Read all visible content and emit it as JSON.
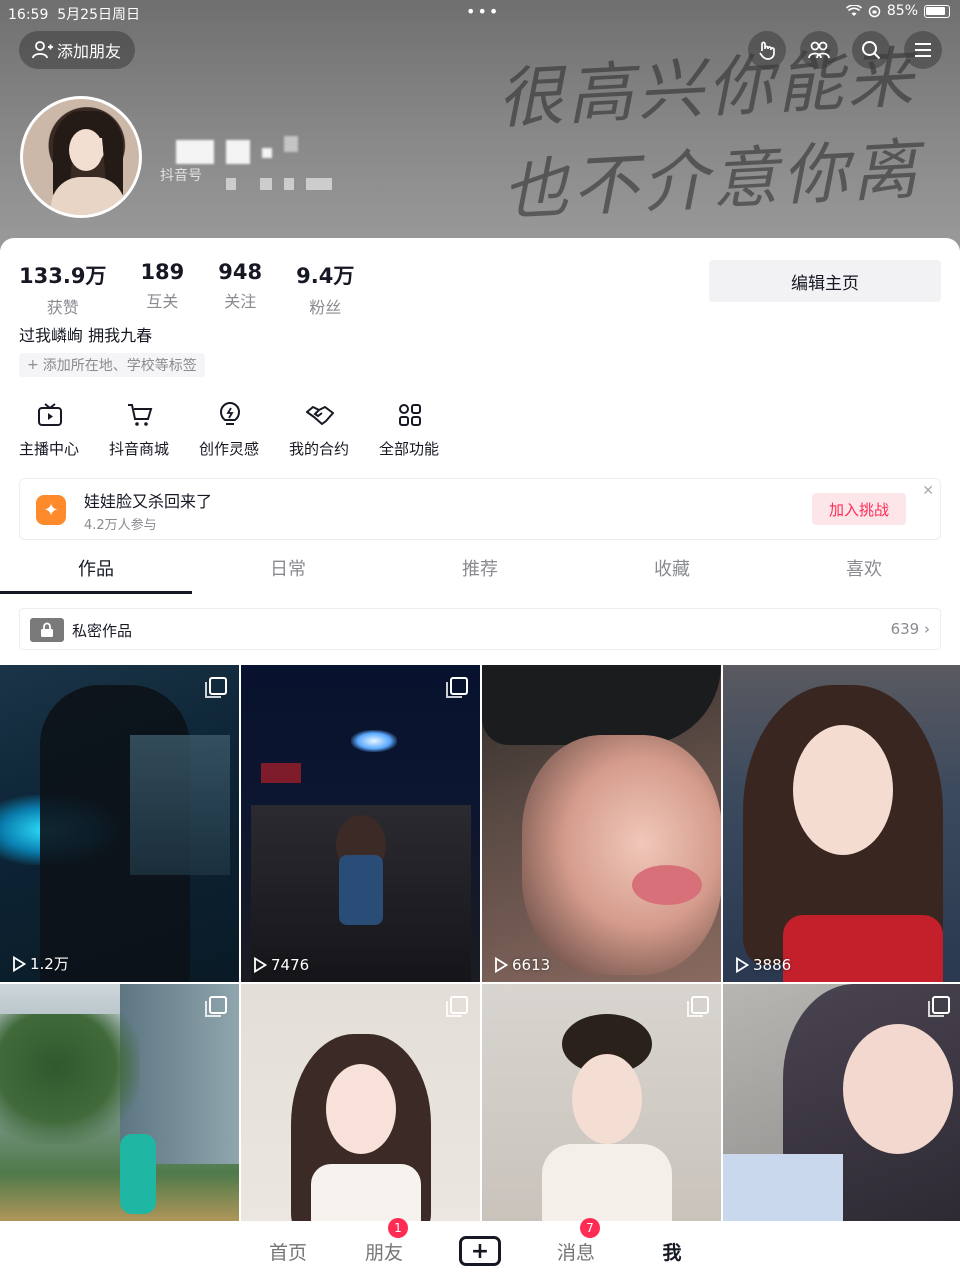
{
  "status": {
    "time": "16:59",
    "date": "5月25日周日",
    "dots": "•••",
    "battery": "85%"
  },
  "banner": {
    "line1": "很高兴你能来",
    "line2": "也不介意你离开"
  },
  "header": {
    "add_friend": "添加朋友",
    "douyin_id_label": "抖音号"
  },
  "stats": [
    {
      "num": "133.9万",
      "label": "获赞"
    },
    {
      "num": "189",
      "label": "互关"
    },
    {
      "num": "948",
      "label": "关注"
    },
    {
      "num": "9.4万",
      "label": "粉丝"
    }
  ],
  "edit_label": "编辑主页",
  "bio": "过我嶙峋 拥我九春",
  "tag_add": "添加所在地、学校等标签",
  "features": [
    {
      "label": "主播中心",
      "icon": "tv-icon"
    },
    {
      "label": "抖音商城",
      "icon": "cart-icon"
    },
    {
      "label": "创作灵感",
      "icon": "bulb-icon"
    },
    {
      "label": "我的合约",
      "icon": "handshake-icon"
    },
    {
      "label": "全部功能",
      "icon": "grid-icon"
    }
  ],
  "promo": {
    "title": "娃娃脸又杀回来了",
    "sub": "4.2万人参与",
    "button": "加入挑战",
    "close": "✕"
  },
  "tabs": [
    "作品",
    "日常",
    "推荐",
    "收藏",
    "喜欢"
  ],
  "private": {
    "label": "私密作品",
    "count": "639 ›"
  },
  "posts": [
    {
      "plays": "1.2万",
      "multi": true
    },
    {
      "plays": "7476",
      "multi": true
    },
    {
      "plays": "6613",
      "multi": false
    },
    {
      "plays": "3886",
      "multi": false
    },
    {
      "plays": "",
      "multi": true
    },
    {
      "plays": "",
      "multi": true
    },
    {
      "plays": "",
      "multi": true
    },
    {
      "plays": "",
      "multi": true
    }
  ],
  "nav": {
    "home": "首页",
    "friends": "朋友",
    "friends_badge": "1",
    "plus": "+",
    "messages": "消息",
    "messages_badge": "7",
    "me": "我"
  },
  "colors": {
    "accent": "#fe2c55",
    "text": "#161823",
    "muted": "#8a8b91"
  }
}
